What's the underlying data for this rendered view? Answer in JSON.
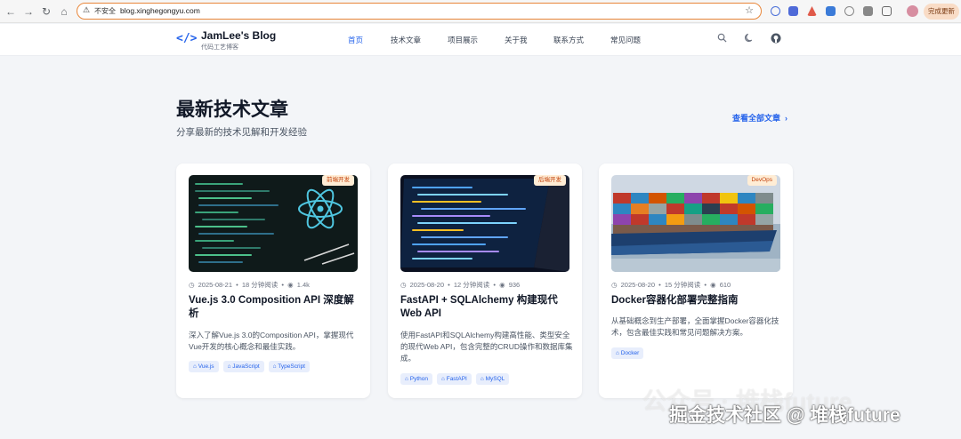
{
  "browser": {
    "insecure_label": "不安全",
    "url": "blog.xinghegongyu.com",
    "update_button": "完成更新"
  },
  "site": {
    "logo_symbol": "</>",
    "title": "JamLee's Blog",
    "subtitle": "代码工艺博客",
    "nav": [
      {
        "label": "首页",
        "active": true
      },
      {
        "label": "技术文章"
      },
      {
        "label": "项目展示"
      },
      {
        "label": "关于我"
      },
      {
        "label": "联系方式"
      },
      {
        "label": "常见问题"
      }
    ],
    "icons": [
      "search-icon",
      "moon-icon",
      "github-icon"
    ]
  },
  "section": {
    "title": "最新技术文章",
    "subtitle": "分享最新的技术见解和开发经验",
    "view_all": "查看全部文章"
  },
  "articles": [
    {
      "category": "前端开发",
      "date": "2025-08-21",
      "read_time": "18 分钟阅读",
      "views": "1.4k",
      "title": "Vue.js 3.0 Composition API 深度解析",
      "description": "深入了解Vue.js 3.0的Composition API，掌握现代Vue开发的核心概念和最佳实践。",
      "tags": [
        "Vue.js",
        "JavaScript",
        "TypeScript"
      ]
    },
    {
      "category": "后端开发",
      "date": "2025-08-20",
      "read_time": "12 分钟阅读",
      "views": "936",
      "title": "FastAPI + SQLAlchemy 构建现代Web API",
      "description": "使用FastAPI和SQLAlchemy构建高性能、类型安全的现代Web API，包含完整的CRUD操作和数据库集成。",
      "tags": [
        "Python",
        "FastAPI",
        "MySQL"
      ]
    },
    {
      "category": "DevOps",
      "date": "2025-08-20",
      "read_time": "15 分钟阅读",
      "views": "610",
      "title": "Docker容器化部署完整指南",
      "description": "从基础概念到生产部署，全面掌握Docker容器化技术，包含最佳实践和常见问题解决方案。",
      "tags": [
        "Docker"
      ]
    }
  ],
  "watermark": {
    "line1": "公众号 · 堆栈future",
    "line2": "掘金技术社区 @ 堆栈future"
  },
  "colors": {
    "accent": "#2563eb",
    "badge_bg": "#ffedd5",
    "badge_text": "#c2410c",
    "url_border": "#e8863a"
  }
}
